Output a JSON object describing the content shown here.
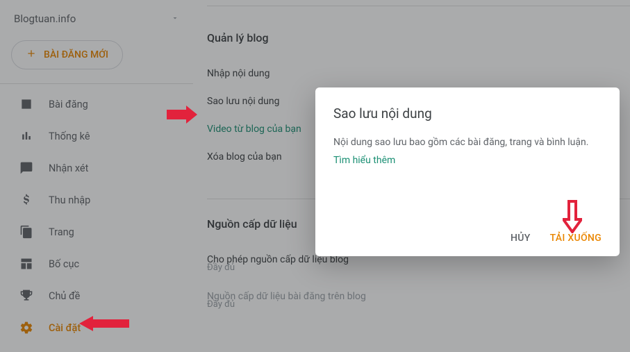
{
  "blog_selector": {
    "name": "Blogtuan.info"
  },
  "new_post_btn": "BÀI ĐĂNG MỚI",
  "sidebar": {
    "items": [
      {
        "key": "posts",
        "label": "Bài đăng"
      },
      {
        "key": "stats",
        "label": "Thống kê"
      },
      {
        "key": "comments",
        "label": "Nhận xét"
      },
      {
        "key": "earnings",
        "label": "Thu nhập"
      },
      {
        "key": "pages",
        "label": "Trang"
      },
      {
        "key": "layout",
        "label": "Bố cục"
      },
      {
        "key": "theme",
        "label": "Chủ đề"
      },
      {
        "key": "settings",
        "label": "Cài đặt"
      }
    ]
  },
  "main": {
    "manage_title": "Quản lý blog",
    "rows": {
      "import": "Nhập nội dung",
      "backup": "Sao lưu nội dung",
      "video": "Video từ blog của bạn",
      "delete": "Xóa blog của bạn"
    },
    "feed_title": "Nguồn cấp dữ liệu",
    "feed_rows": {
      "allow": "Cho phép nguồn cấp dữ liệu blog",
      "allow_value": "Đầy đủ",
      "posts": "Nguồn cấp dữ liệu bài đăng trên blog",
      "posts_value": "Đầy đủ"
    }
  },
  "dialog": {
    "title": "Sao lưu nội dung",
    "desc": "Nội dung sao lưu bao gồm các bài đăng, trang và bình luận.",
    "learn_more": "Tìm hiểu thêm",
    "cancel": "HỦY",
    "download": "TẢI XUỐNG"
  }
}
